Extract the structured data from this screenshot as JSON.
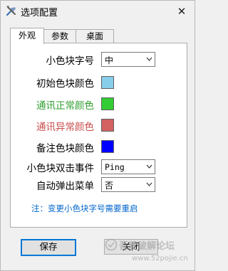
{
  "window": {
    "title": "选项配置",
    "close_label": "✕"
  },
  "tabs": [
    {
      "label": "外观",
      "active": true
    },
    {
      "label": "参数",
      "active": false
    },
    {
      "label": "桌面",
      "active": false
    }
  ],
  "form": {
    "font_size": {
      "label": "小色块字号",
      "value": "中"
    },
    "initial_color": {
      "label": "初始色块颜色",
      "color": "#87ceeb",
      "label_color": "#000000"
    },
    "normal_color": {
      "label": "通讯正常颜色",
      "color": "#33cc33",
      "label_color": "#2e9e2e"
    },
    "abnormal_color": {
      "label": "通讯异常颜色",
      "color": "#d46161",
      "label_color": "#c84b4b"
    },
    "note_color": {
      "label": "备注色块颜色",
      "color": "#0000ff",
      "label_color": "#000000"
    },
    "double_click": {
      "label": "小色块双击事件",
      "value": "Ping"
    },
    "auto_popup": {
      "label": "自动弹出菜单",
      "value": "否"
    },
    "note": {
      "text": "注：变更小色块字号需要重启",
      "color": "#0066cc"
    }
  },
  "buttons": {
    "save_label": "保存",
    "close_label": "关闭"
  },
  "watermark": {
    "line1": "吾爱破解论坛",
    "line2": "www.52pojie.cn"
  },
  "colors": {
    "accent": "#0078d7"
  }
}
